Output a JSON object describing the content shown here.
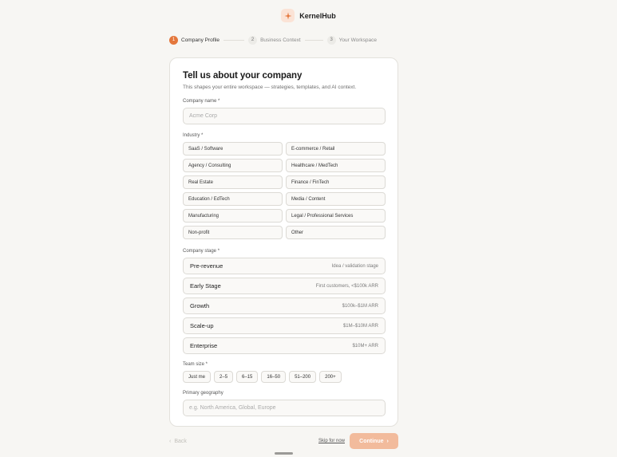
{
  "brand": {
    "name": "KernelHub",
    "logo_icon": "sparkle-icon",
    "accent": "#e4773c"
  },
  "stepper": {
    "steps": [
      {
        "num": "1",
        "label": "Company Profile",
        "active": true
      },
      {
        "num": "2",
        "label": "Business Context",
        "active": false
      },
      {
        "num": "3",
        "label": "Your Workspace",
        "active": false
      }
    ]
  },
  "form": {
    "title": "Tell us about your company",
    "subtitle": "This shapes your entire workspace — strategies, templates, and AI context.",
    "company_name": {
      "label": "Company name *",
      "placeholder": "Acme Corp",
      "value": ""
    },
    "industry": {
      "label": "Industry *",
      "options": [
        "SaaS / Software",
        "E-commerce / Retail",
        "Agency / Consulting",
        "Healthcare / MedTech",
        "Real Estate",
        "Finance / FinTech",
        "Education / EdTech",
        "Media / Content",
        "Manufacturing",
        "Legal / Professional Services",
        "Non-profit",
        "Other"
      ]
    },
    "stage": {
      "label": "Company stage *",
      "options": [
        {
          "name": "Pre-revenue",
          "desc": "Idea / validation stage"
        },
        {
          "name": "Early Stage",
          "desc": "First customers, <$100k ARR"
        },
        {
          "name": "Growth",
          "desc": "$100k–$1M ARR"
        },
        {
          "name": "Scale-up",
          "desc": "$1M–$10M ARR"
        },
        {
          "name": "Enterprise",
          "desc": "$10M+ ARR"
        }
      ]
    },
    "team_size": {
      "label": "Team size *",
      "options": [
        "Just me",
        "2–5",
        "6–15",
        "16–50",
        "51–200",
        "200+"
      ]
    },
    "geography": {
      "label": "Primary geography",
      "placeholder": "e.g. North America, Global, Europe",
      "value": ""
    }
  },
  "footer": {
    "back_label": "Back",
    "skip_label": "Skip for now",
    "continue_label": "Continue"
  }
}
